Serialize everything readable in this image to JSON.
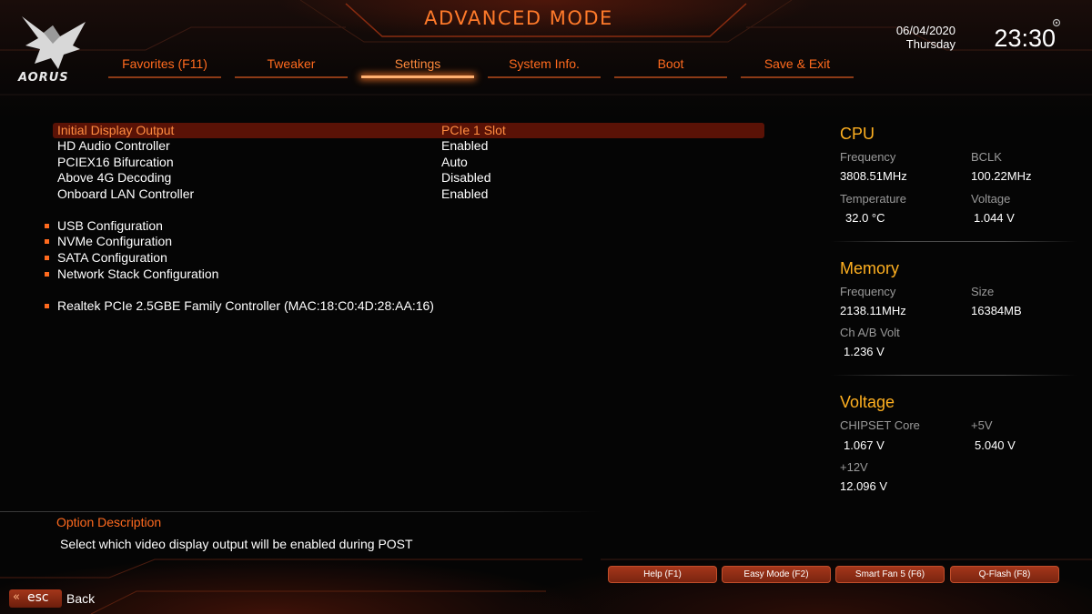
{
  "header": {
    "logo_text": "AORUS",
    "mode_title": "ADVANCED MODE",
    "date": "06/04/2020",
    "day": "Thursday",
    "time": "23:30"
  },
  "tabs": [
    {
      "label": "Favorites (F11)"
    },
    {
      "label": "Tweaker"
    },
    {
      "label": "Settings",
      "active": true
    },
    {
      "label": "System Info."
    },
    {
      "label": "Boot"
    },
    {
      "label": "Save & Exit"
    }
  ],
  "settings": {
    "items": [
      {
        "label": "Initial Display Output",
        "value": "PCIe 1 Slot",
        "selected": true
      },
      {
        "label": "HD Audio Controller",
        "value": "Enabled"
      },
      {
        "label": "PCIEX16 Bifurcation",
        "value": "Auto"
      },
      {
        "label": "Above 4G Decoding",
        "value": "Disabled"
      },
      {
        "label": "Onboard LAN Controller",
        "value": "Enabled"
      }
    ],
    "submenus": [
      {
        "label": "USB Configuration"
      },
      {
        "label": "NVMe Configuration"
      },
      {
        "label": "SATA Configuration"
      },
      {
        "label": "Network Stack Configuration"
      },
      {
        "label": "Realtek PCIe 2.5GBE Family Controller (MAC:18:C0:4D:28:AA:16)"
      }
    ]
  },
  "description": {
    "title": "Option Description",
    "text": "Select which video display output will be enabled during POST"
  },
  "info": {
    "cpu": {
      "title": "CPU",
      "frequency_label": "Frequency",
      "frequency": "3808.51MHz",
      "bclk_label": "BCLK",
      "bclk": "100.22MHz",
      "temperature_label": "Temperature",
      "temperature": "32.0 °C",
      "voltage_label": "Voltage",
      "voltage": "1.044 V"
    },
    "memory": {
      "title": "Memory",
      "frequency_label": "Frequency",
      "frequency": "2138.11MHz",
      "size_label": "Size",
      "size": "16384MB",
      "chvolt_label": "Ch A/B Volt",
      "chvolt": "1.236 V"
    },
    "voltage": {
      "title": "Voltage",
      "chipset_label": "CHIPSET Core",
      "chipset": "1.067 V",
      "v5_label": "+5V",
      "v5": "5.040 V",
      "v12_label": "+12V",
      "v12": "12.096 V"
    }
  },
  "footer": {
    "help": "Help (F1)",
    "easy_mode": "Easy Mode (F2)",
    "smart_fan": "Smart Fan 5 (F6)",
    "qflash": "Q-Flash (F8)",
    "esc_chevron": "«",
    "esc_label": "esc",
    "back_label": "Back"
  },
  "colors": {
    "accent": "#ff6a1e",
    "selected_row_bg": "#5a1206",
    "section_title": "#ffb020",
    "label_gray": "#9a9a9a"
  }
}
